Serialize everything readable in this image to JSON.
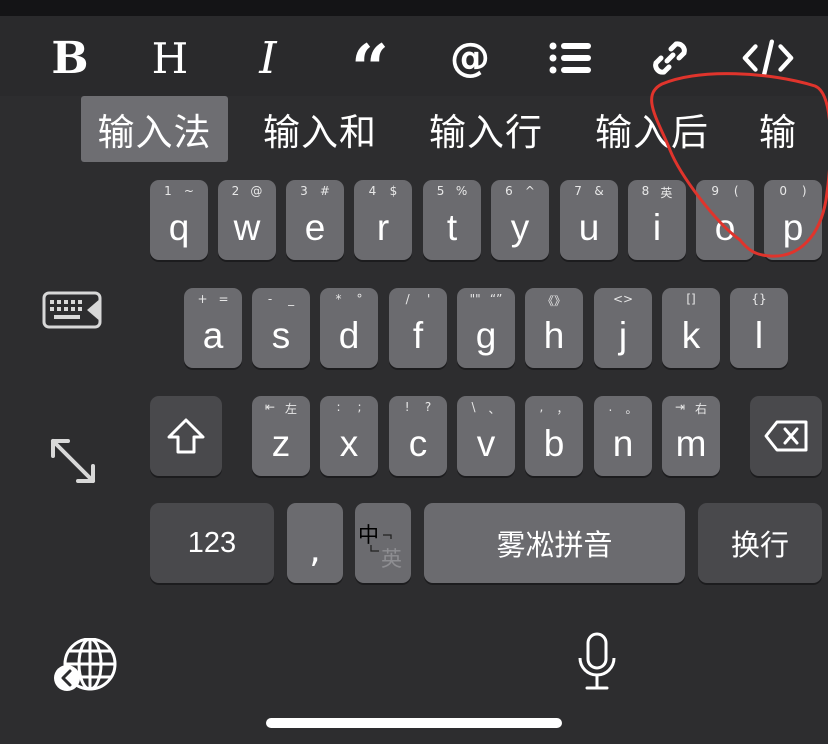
{
  "toolbar": {
    "buttons": [
      {
        "name": "bold-button",
        "label": "B",
        "icon": "bold-icon"
      },
      {
        "name": "heading-button",
        "label": "H",
        "icon": "heading-icon"
      },
      {
        "name": "italic-button",
        "label": "I",
        "icon": "italic-icon"
      },
      {
        "name": "quote-button",
        "label": "“",
        "icon": "quote-icon"
      },
      {
        "name": "mention-button",
        "label": "@",
        "icon": "at-icon"
      },
      {
        "name": "list-button",
        "icon": "list-icon"
      },
      {
        "name": "link-button",
        "icon": "link-icon"
      },
      {
        "name": "code-button",
        "icon": "code-icon"
      }
    ]
  },
  "candidates": [
    "输入法",
    "输入和",
    "输入行",
    "输入后",
    "输"
  ],
  "keyboard": {
    "row1": [
      {
        "key": "q",
        "alt1": "1",
        "alt2": "~"
      },
      {
        "key": "w",
        "alt1": "2",
        "alt2": "@"
      },
      {
        "key": "e",
        "alt1": "3",
        "alt2": "#"
      },
      {
        "key": "r",
        "alt1": "4",
        "alt2": "$"
      },
      {
        "key": "t",
        "alt1": "5",
        "alt2": "%"
      },
      {
        "key": "y",
        "alt1": "6",
        "alt2": "^"
      },
      {
        "key": "u",
        "alt1": "7",
        "alt2": "&"
      },
      {
        "key": "i",
        "alt1": "8",
        "alt2": "英"
      },
      {
        "key": "o",
        "alt1": "9",
        "alt2": "("
      },
      {
        "key": "p",
        "alt1": "0",
        "alt2": ")"
      }
    ],
    "row2": [
      {
        "key": "a",
        "alt1": "+",
        "alt2": "="
      },
      {
        "key": "s",
        "alt1": "-",
        "alt2": "_"
      },
      {
        "key": "d",
        "alt1": "*",
        "alt2": "°"
      },
      {
        "key": "f",
        "alt1": "/",
        "alt2": "'"
      },
      {
        "key": "g",
        "alt1": "\"\"",
        "alt2": "“”"
      },
      {
        "key": "h",
        "alt1": "《》",
        "alt2": ""
      },
      {
        "key": "j",
        "alt1": "<>",
        "alt2": ""
      },
      {
        "key": "k",
        "alt1": "[]",
        "alt2": ""
      },
      {
        "key": "l",
        "alt1": "{}",
        "alt2": ""
      }
    ],
    "row3": [
      {
        "key": "z",
        "alt1": "⇤",
        "alt2": "左"
      },
      {
        "key": "x",
        "alt1": ":",
        "alt2": ";"
      },
      {
        "key": "c",
        "alt1": "!",
        "alt2": "?"
      },
      {
        "key": "v",
        "alt1": "\\",
        "alt2": "、"
      },
      {
        "key": "b",
        "alt1": ",",
        "alt2": "，"
      },
      {
        "key": "n",
        "alt1": ".",
        "alt2": "。"
      },
      {
        "key": "m",
        "alt1": "⇥",
        "alt2": "右"
      }
    ],
    "numbers_label": "123",
    "comma_label": ",",
    "lang_switch_primary": "中",
    "lang_switch_secondary": "英",
    "space_label": "雾凇拼音",
    "return_label": "换行"
  },
  "colors": {
    "background": "#2d2d2f",
    "key": "#6b6b6f",
    "function_key": "#49494c",
    "selected_candidate": "#6e6e72",
    "annotation": "#e0342c"
  }
}
